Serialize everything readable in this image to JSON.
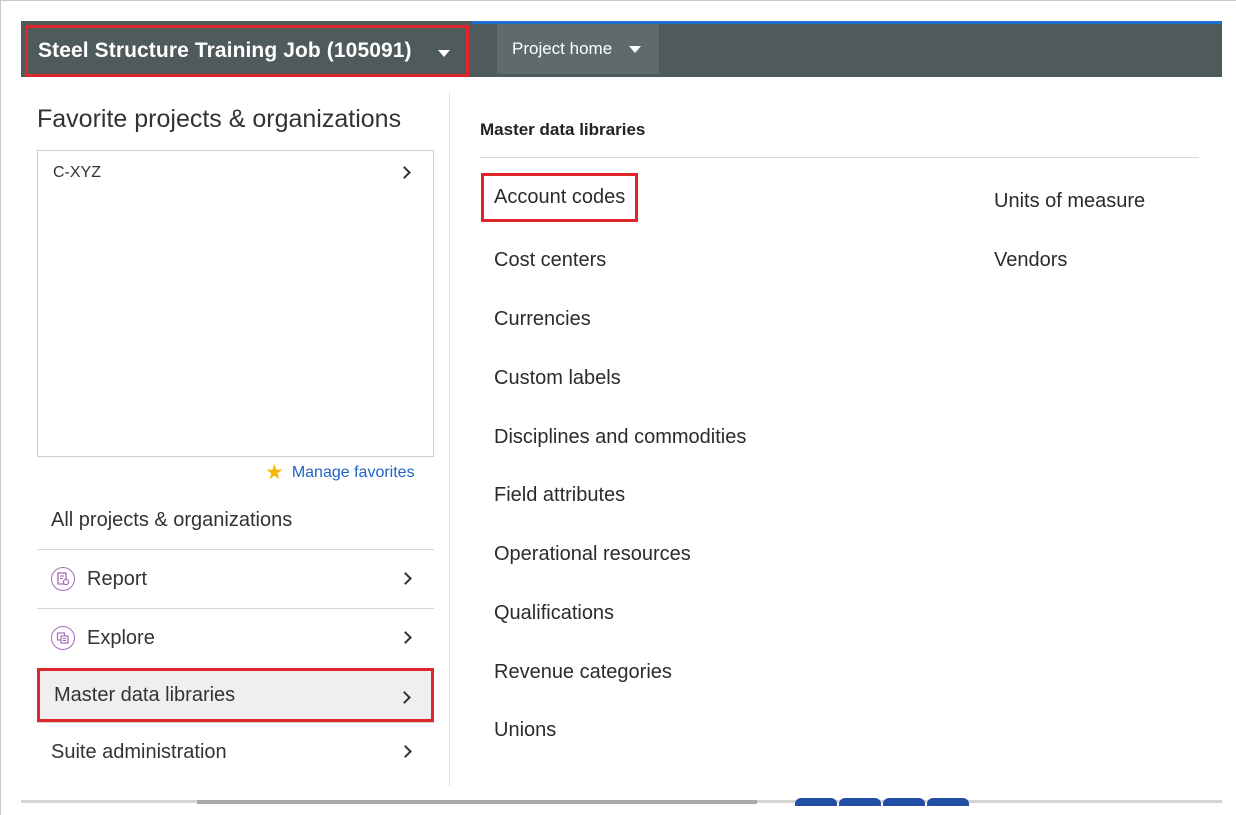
{
  "topbar": {
    "project_selector": "Steel Structure Training Job (105091)",
    "project_home": "Project home"
  },
  "favorites": {
    "title": "Favorite projects & organizations",
    "items": [
      {
        "label": "C-XYZ"
      }
    ],
    "manage_label": "Manage favorites"
  },
  "nav": {
    "all_projects": "All projects & organizations",
    "items": [
      {
        "label": "Report",
        "icon": "report-icon"
      },
      {
        "label": "Explore",
        "icon": "explore-icon"
      },
      {
        "label": "Master data libraries",
        "selected": true
      },
      {
        "label": "Suite administration"
      }
    ]
  },
  "master_data": {
    "title": "Master data libraries",
    "column1": [
      "Account codes",
      "Cost centers",
      "Currencies",
      "Custom labels",
      "Disciplines and commodities",
      "Field attributes",
      "Operational resources",
      "Qualifications",
      "Revenue categories",
      "Unions"
    ],
    "column2": [
      "Units of measure",
      "Vendors"
    ]
  },
  "colors": {
    "topbar": "#4f5a5b",
    "highlight": "#e0262b",
    "link": "#1f63c6",
    "star": "#f5b800"
  }
}
